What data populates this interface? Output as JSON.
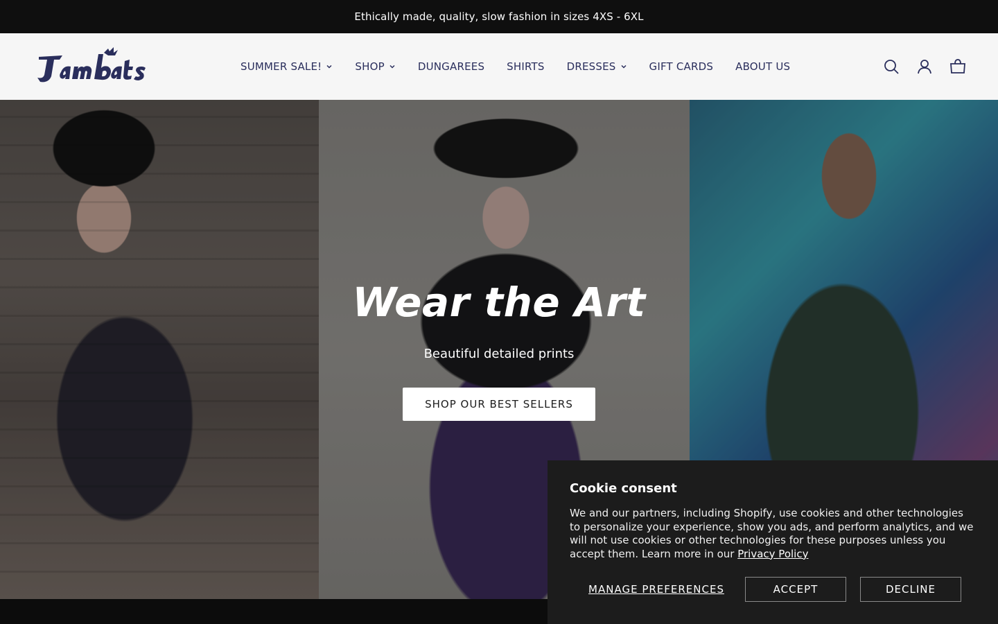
{
  "announcement": "Ethically made, quality, slow fashion in sizes 4XS - 6XL",
  "brand": {
    "logo_text": "Jambats",
    "color": "#2a2e5c"
  },
  "nav": [
    {
      "label": "SUMMER SALE!",
      "has_dropdown": true
    },
    {
      "label": "SHOP",
      "has_dropdown": true
    },
    {
      "label": "DUNGAREES",
      "has_dropdown": false
    },
    {
      "label": "SHIRTS",
      "has_dropdown": false
    },
    {
      "label": "DRESSES",
      "has_dropdown": true
    },
    {
      "label": "GIFT CARDS",
      "has_dropdown": false
    },
    {
      "label": "ABOUT US",
      "has_dropdown": false
    }
  ],
  "header_icons": [
    "search-icon",
    "account-icon",
    "cart-icon"
  ],
  "hero": {
    "title": "Wear the Art",
    "subtitle": "Beautiful detailed prints",
    "cta": "SHOP OUR BEST SELLERS"
  },
  "cookie": {
    "title": "Cookie consent",
    "body": "We and our partners, including Shopify, use cookies and other technologies to personalize your experience, show you ads, and perform analytics, and we will not use cookies or other technologies for these purposes unless you accept them. Learn more in our ",
    "link": "Privacy Policy",
    "manage": "MANAGE PREFERENCES",
    "accept": "ACCEPT",
    "decline": "DECLINE"
  },
  "colors": {
    "announcement_bg": "#0f0f0f",
    "header_bg": "#f6f6f6",
    "nav_text": "#2a2e5c",
    "cookie_bg": "#1c1c1c"
  }
}
